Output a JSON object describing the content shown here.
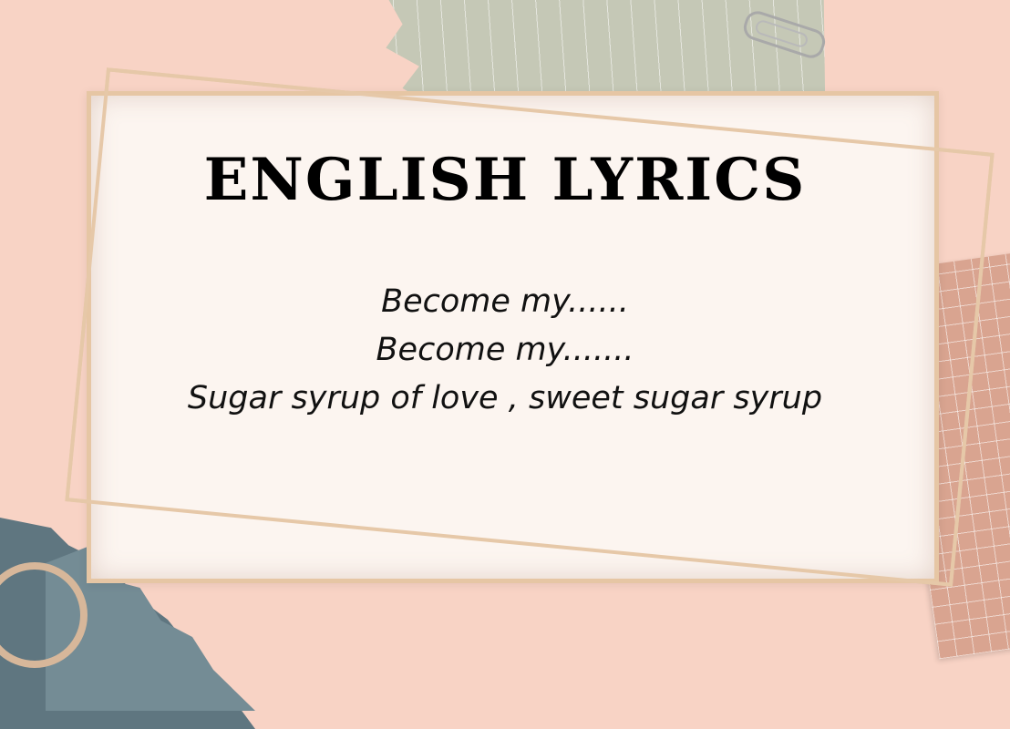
{
  "card": {
    "title": "ENGLISH LYRICS",
    "lyrics": [
      "Become my......",
      "Become my.......",
      "Sugar syrup of love , sweet sugar syrup"
    ]
  },
  "colors": {
    "background": "#f8d3c5",
    "card": "#fcf5f0",
    "frame": "#e6c6a4",
    "green_paper": "#c5c8b6",
    "grid_paper": "#d9a490",
    "teal_paper": "#5f7680"
  }
}
